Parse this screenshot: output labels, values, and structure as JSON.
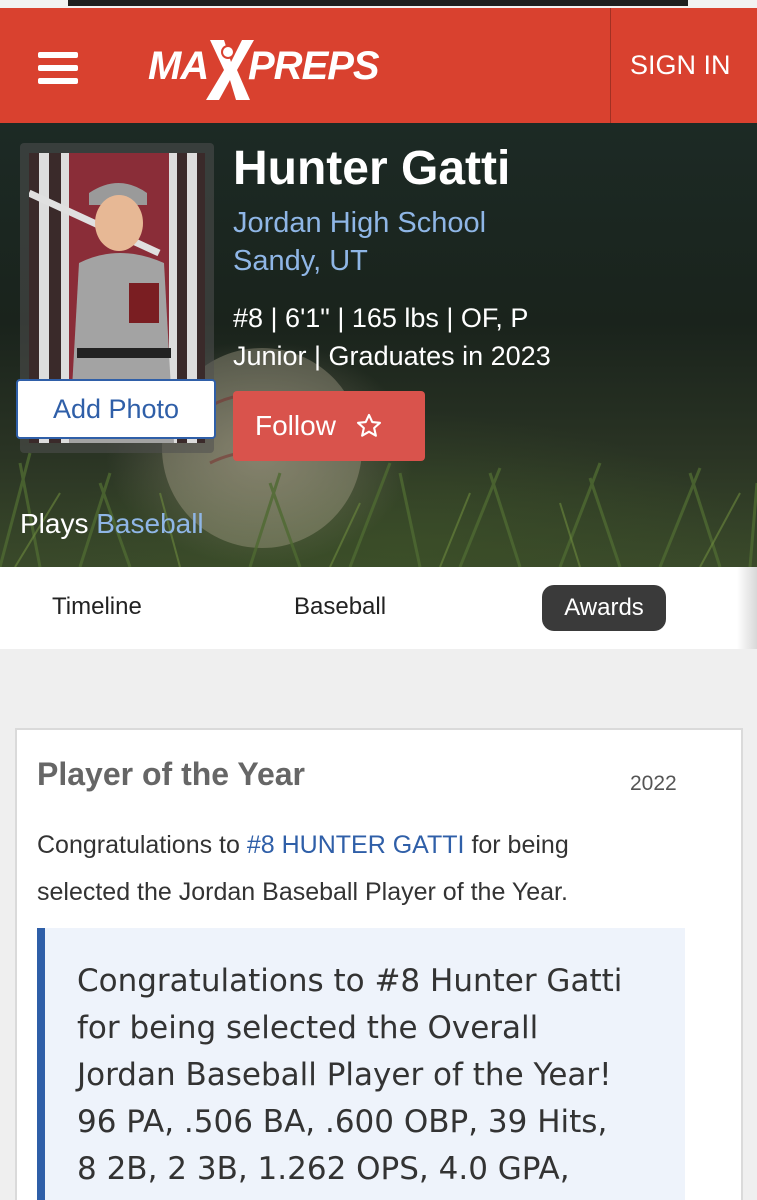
{
  "header": {
    "logo_left": "MA",
    "logo_right": "PREPS",
    "sign_in": "SIGN IN"
  },
  "profile": {
    "name": "Hunter Gatti",
    "school": "Jordan High School",
    "location": "Sandy, UT",
    "stats_line": "#8 | 6'1\" | 165 lbs | OF, P",
    "class_line": "Junior | Graduates in 2023",
    "add_photo": "Add Photo",
    "follow": "Follow",
    "plays_prefix": "Plays",
    "plays_sport": "Baseball"
  },
  "tabs": [
    {
      "label": "Timeline",
      "active": false
    },
    {
      "label": "Baseball",
      "active": false
    },
    {
      "label": "Awards",
      "active": true
    }
  ],
  "award": {
    "title": "Player of the Year",
    "year": "2022",
    "body_prefix": "Congratulations to",
    "body_link": "#8 HUNTER GATTI",
    "body_line1_suffix": "for being",
    "body_line2": "selected the Jordan Baseball Player of the Year.",
    "quote_lines": [
      "Congratulations to #8 Hunter Gatti",
      "for being selected the Overall",
      "Jordan Baseball Player of the Year!",
      "96 PA, .506 BA, .600 OBP, 39 Hits,",
      "8 2B, 2 3B, 1.262 OPS, 4.0 GPA,"
    ]
  },
  "colors": {
    "brand_red": "#d9412f",
    "follow_red": "#d9534c",
    "link_blue": "#2f5fa8",
    "light_link_blue": "#8fb6e6",
    "active_tab": "#3a3a3a"
  },
  "icons": {
    "menu": "hamburger-menu-icon",
    "follow": "star-outline-icon"
  }
}
